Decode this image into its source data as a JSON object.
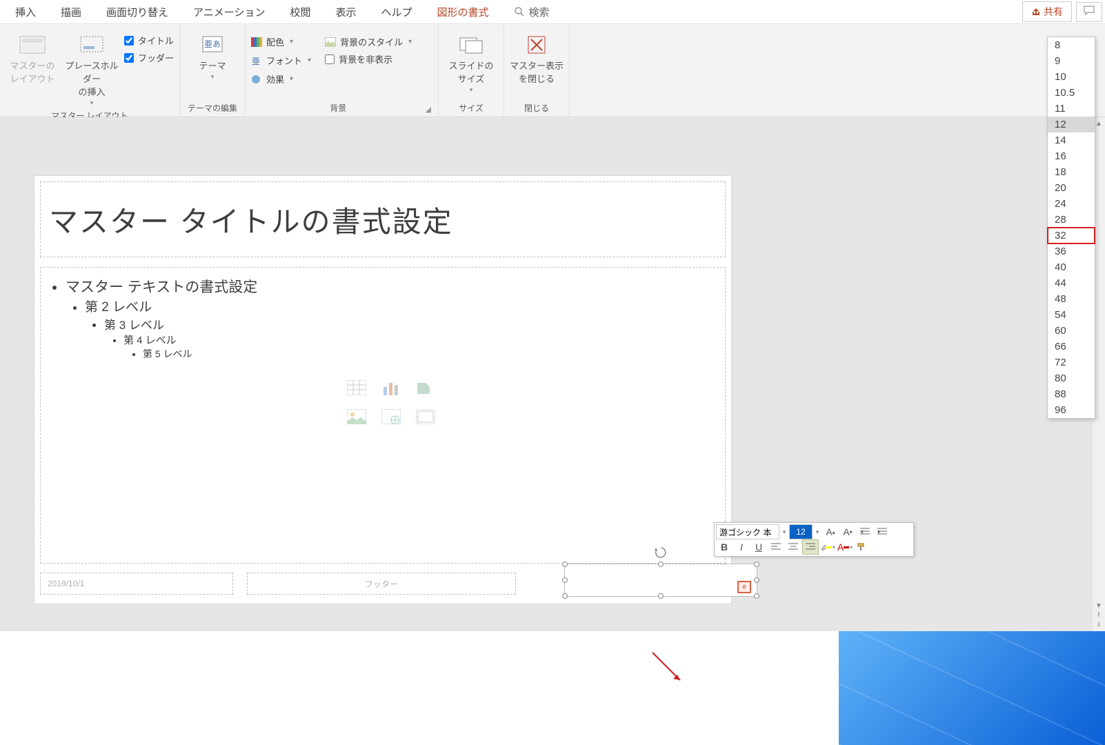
{
  "menubar": {
    "tabs": [
      "挿入",
      "描画",
      "画面切り替え",
      "アニメーション",
      "校閲",
      "表示",
      "ヘルプ"
    ],
    "active_tab": "図形の書式",
    "search_label": "検索",
    "share_label": "共有"
  },
  "ribbon": {
    "group_master_layout": {
      "label": "マスター レイアウト",
      "master_layout_btn": "マスターの\nレイアウト",
      "placeholder_insert_btn": "プレースホルダー\nの挿入",
      "chk_title": "タイトル",
      "chk_footer": "フッダー"
    },
    "group_theme": {
      "label": "テーマの編集",
      "theme_btn": "テーマ"
    },
    "group_background": {
      "label": "背景",
      "colors": "配色",
      "fonts": "フォント",
      "effects": "効果",
      "bg_styles": "背景のスタイル",
      "hide_bg": "背景を非表示"
    },
    "group_size": {
      "label": "サイズ",
      "slide_size_btn": "スライドの\nサイズ"
    },
    "group_close": {
      "label": "閉じる",
      "close_master_btn": "マスター表示\nを閉じる"
    }
  },
  "slide": {
    "title_placeholder": "マスター タイトルの書式設定",
    "body_levels": [
      "マスター テキストの書式設定",
      "第 2 レベル",
      "第 3 レベル",
      "第 4 レベル",
      "第 5 レベル"
    ],
    "date_placeholder": "2019/10/1",
    "footer_placeholder": "フッター",
    "slide_number_symbol": "#"
  },
  "font_size_dropdown": {
    "items": [
      "8",
      "9",
      "10",
      "10.5",
      "11",
      "12",
      "14",
      "16",
      "18",
      "20",
      "24",
      "28",
      "32",
      "36",
      "40",
      "44",
      "48",
      "54",
      "60",
      "66",
      "72",
      "80",
      "88",
      "96"
    ],
    "selected": "12",
    "highlighted": "32"
  },
  "mini_toolbar": {
    "font_name": "游ゴシック 本",
    "font_size": "12"
  }
}
